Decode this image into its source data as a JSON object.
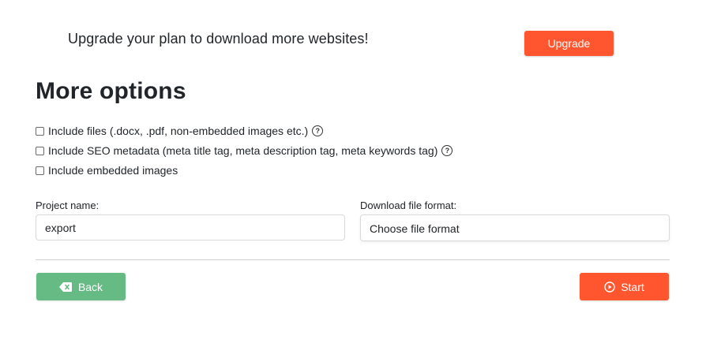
{
  "upgrade_banner": {
    "text": "Upgrade your plan to download more websites!",
    "button_label": "Upgrade"
  },
  "options": {
    "title": "More options",
    "items": [
      {
        "label": "Include files (.docx, .pdf, non-embedded images etc.)",
        "checked": false,
        "has_help": true
      },
      {
        "label": "Include SEO metadata (meta title tag, meta description tag, meta keywords tag)",
        "checked": false,
        "has_help": true
      },
      {
        "label": "Include embedded images",
        "checked": false,
        "has_help": false
      }
    ],
    "help_glyph": "?"
  },
  "form": {
    "project_name_label": "Project name:",
    "project_name_value": "export",
    "file_format_label": "Download file format:",
    "file_format_value": "Choose file format"
  },
  "actions": {
    "back_label": "Back",
    "start_label": "Start"
  },
  "colors": {
    "accent_orange": "#ff5630",
    "back_green": "#66bb85"
  },
  "icons": {
    "back": "backspace-icon",
    "start": "play-circle-icon",
    "help": "question-circle-icon"
  }
}
